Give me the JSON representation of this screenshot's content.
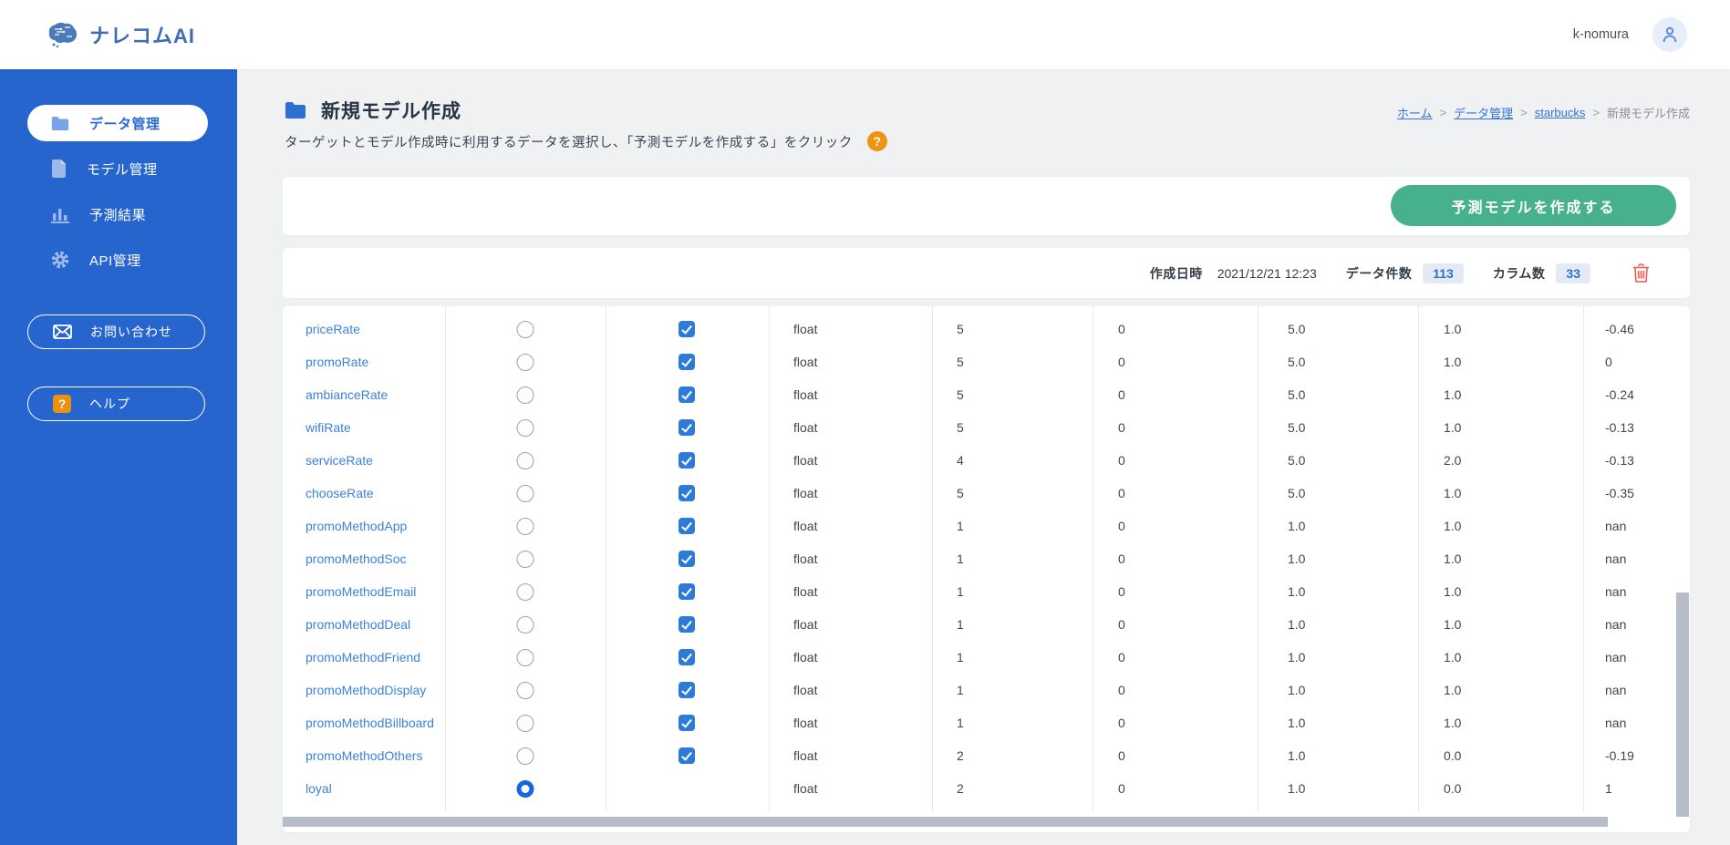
{
  "header": {
    "logo_text": "ナレコムAI",
    "username": "k-nomura"
  },
  "sidebar": {
    "items": [
      {
        "label": "データ管理",
        "icon": "folder",
        "active": true
      },
      {
        "label": "モデル管理",
        "icon": "file",
        "active": false
      },
      {
        "label": "予測結果",
        "icon": "bar-chart",
        "active": false
      },
      {
        "label": "API管理",
        "icon": "gear",
        "active": false
      }
    ],
    "buttons": [
      {
        "label": "お問い合わせ",
        "icon": "mail"
      },
      {
        "label": "ヘルプ",
        "icon": "question"
      }
    ]
  },
  "page": {
    "title": "新規モデル作成",
    "description": "ターゲットとモデル作成時に利用するデータを選択し、「予測モデルを作成する」をクリック",
    "breadcrumb": [
      {
        "label": "ホーム",
        "link": true
      },
      {
        "label": "データ管理",
        "link": true
      },
      {
        "label": "starbucks",
        "link": true
      },
      {
        "label": "新規モデル作成",
        "link": false
      }
    ],
    "create_button_label": "予測モデルを作成する",
    "meta": {
      "created_label": "作成日時",
      "created_value": "2021/12/21 12:23",
      "rows_label": "データ件数",
      "rows_value": "113",
      "cols_label": "カラム数",
      "cols_value": "33"
    }
  },
  "table": {
    "rows": [
      {
        "name": "priceRate",
        "radio": false,
        "checkbox": true,
        "type": "float",
        "values": [
          "5",
          "0",
          "5.0",
          "1.0",
          "-0.46"
        ]
      },
      {
        "name": "promoRate",
        "radio": false,
        "checkbox": true,
        "type": "float",
        "values": [
          "5",
          "0",
          "5.0",
          "1.0",
          "0"
        ]
      },
      {
        "name": "ambianceRate",
        "radio": false,
        "checkbox": true,
        "type": "float",
        "values": [
          "5",
          "0",
          "5.0",
          "1.0",
          "-0.24"
        ]
      },
      {
        "name": "wifiRate",
        "radio": false,
        "checkbox": true,
        "type": "float",
        "values": [
          "5",
          "0",
          "5.0",
          "1.0",
          "-0.13"
        ]
      },
      {
        "name": "serviceRate",
        "radio": false,
        "checkbox": true,
        "type": "float",
        "values": [
          "4",
          "0",
          "5.0",
          "2.0",
          "-0.13"
        ]
      },
      {
        "name": "chooseRate",
        "radio": false,
        "checkbox": true,
        "type": "float",
        "values": [
          "5",
          "0",
          "5.0",
          "1.0",
          "-0.35"
        ]
      },
      {
        "name": "promoMethodApp",
        "radio": false,
        "checkbox": true,
        "type": "float",
        "values": [
          "1",
          "0",
          "1.0",
          "1.0",
          "nan"
        ]
      },
      {
        "name": "promoMethodSoc",
        "radio": false,
        "checkbox": true,
        "type": "float",
        "values": [
          "1",
          "0",
          "1.0",
          "1.0",
          "nan"
        ]
      },
      {
        "name": "promoMethodEmail",
        "radio": false,
        "checkbox": true,
        "type": "float",
        "values": [
          "1",
          "0",
          "1.0",
          "1.0",
          "nan"
        ]
      },
      {
        "name": "promoMethodDeal",
        "radio": false,
        "checkbox": true,
        "type": "float",
        "values": [
          "1",
          "0",
          "1.0",
          "1.0",
          "nan"
        ]
      },
      {
        "name": "promoMethodFriend",
        "radio": false,
        "checkbox": true,
        "type": "float",
        "values": [
          "1",
          "0",
          "1.0",
          "1.0",
          "nan"
        ]
      },
      {
        "name": "promoMethodDisplay",
        "radio": false,
        "checkbox": true,
        "type": "float",
        "values": [
          "1",
          "0",
          "1.0",
          "1.0",
          "nan"
        ]
      },
      {
        "name": "promoMethodBillboard",
        "radio": false,
        "checkbox": true,
        "type": "float",
        "values": [
          "1",
          "0",
          "1.0",
          "1.0",
          "nan"
        ]
      },
      {
        "name": "promoMethodOthers",
        "radio": false,
        "checkbox": true,
        "type": "float",
        "values": [
          "2",
          "0",
          "1.0",
          "0.0",
          "-0.19"
        ]
      },
      {
        "name": "loyal",
        "radio": true,
        "checkbox": null,
        "type": "float",
        "values": [
          "2",
          "0",
          "1.0",
          "0.0",
          "1"
        ]
      }
    ]
  },
  "colors": {
    "sidebar_blue": "#2565cd",
    "brand_blue": "#3a6db6",
    "link_blue": "#3273dc",
    "accent_green": "#46b18c",
    "help_orange": "#ed9413",
    "trash_red": "#ee5a4f",
    "badge_bg": "#e3eaf4",
    "checkbox_blue": "#2e7ad7",
    "radio_checked_blue": "#1767e2"
  }
}
